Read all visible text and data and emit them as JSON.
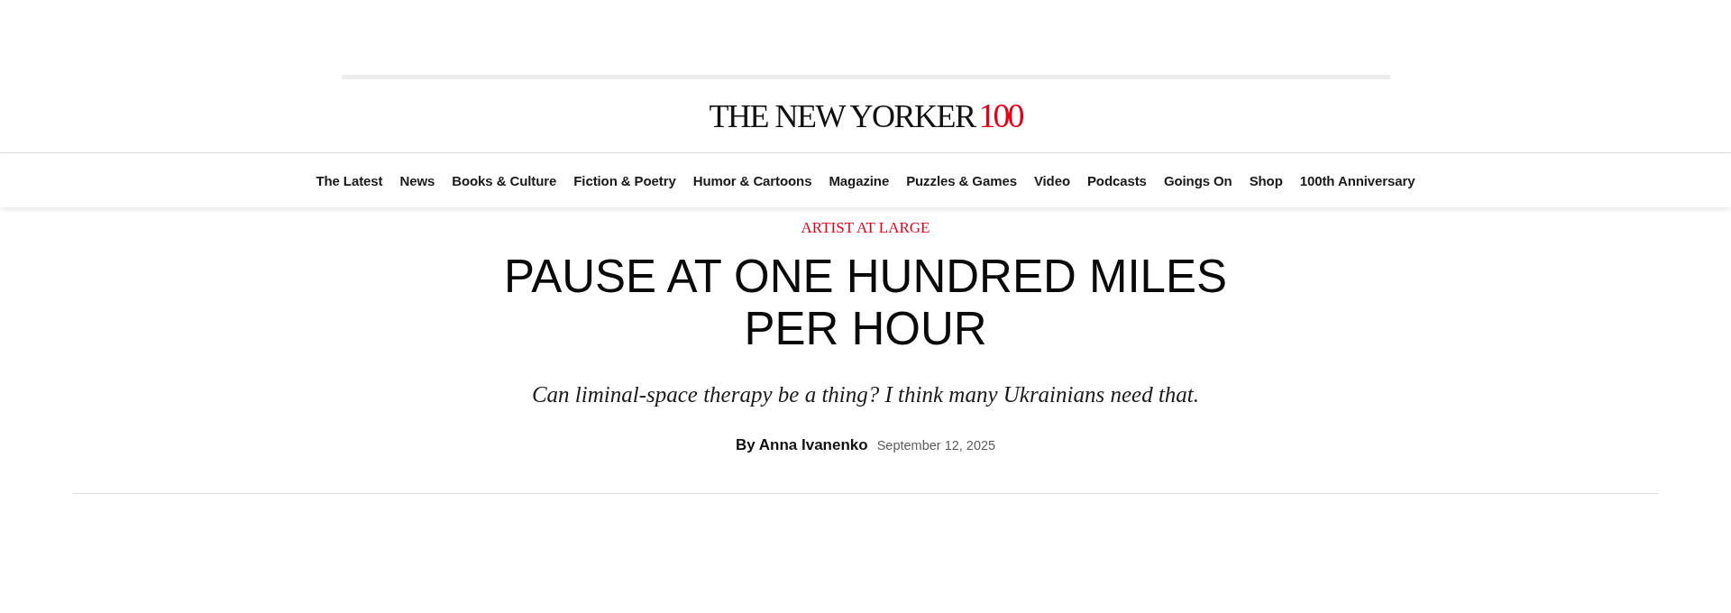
{
  "masthead": {
    "logo_text": "THE NEW YORKER",
    "logo_badge": "100"
  },
  "nav": {
    "items": [
      {
        "label": "The Latest"
      },
      {
        "label": "News"
      },
      {
        "label": "Books & Culture"
      },
      {
        "label": "Fiction & Poetry"
      },
      {
        "label": "Humor & Cartoons"
      },
      {
        "label": "Magazine"
      },
      {
        "label": "Puzzles & Games"
      },
      {
        "label": "Video"
      },
      {
        "label": "Podcasts"
      },
      {
        "label": "Goings On"
      },
      {
        "label": "Shop"
      },
      {
        "label": "100th Anniversary"
      }
    ]
  },
  "article": {
    "rubric": "ARTIST AT LARGE",
    "headline": "PAUSE AT ONE HUNDRED MILES PER HOUR",
    "dek": "Can liminal-space therapy be a thing? I think many Ukrainians need that.",
    "byline": "By Anna Ivanenko",
    "date": "September 12, 2025"
  }
}
